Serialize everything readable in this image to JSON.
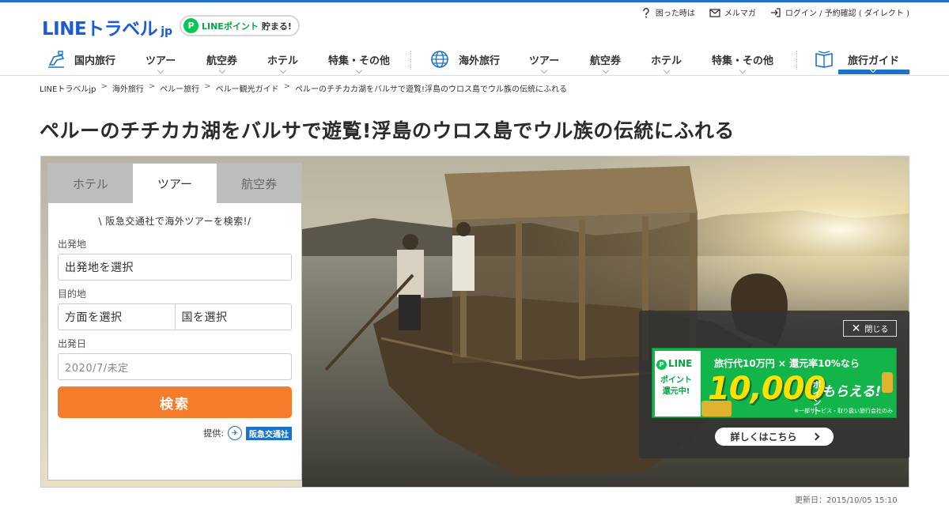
{
  "header": {
    "logo_main": "LINEトラベル",
    "logo_suffix": "jp",
    "point_badge": {
      "icon": "P",
      "line_text": "LINEポイント",
      "rest_text": "貯まる!"
    },
    "util_links": [
      {
        "label": "困った時は",
        "icon": "help-icon"
      },
      {
        "label": "メルマガ",
        "icon": "mail-icon"
      },
      {
        "label": "ログイン / 予約確認 ( ダイレクト )",
        "icon": "login-icon"
      }
    ]
  },
  "nav": {
    "domestic": {
      "label": "国内旅行",
      "items": [
        "ツアー",
        "航空券",
        "ホテル",
        "特集・その他"
      ]
    },
    "overseas": {
      "label": "海外旅行",
      "items": [
        "ツアー",
        "航空券",
        "ホテル",
        "特集・その他"
      ]
    },
    "guide": {
      "label": "旅行ガイド"
    }
  },
  "breadcrumb": [
    "LINEトラベルjp",
    "海外旅行",
    "ペルー旅行",
    "ペルー観光ガイド",
    "ペルーのチチカカ湖をバルサで遊覧!浮島のウロス島でウル族の伝統にふれる"
  ],
  "breadcrumb_sep": ">",
  "page_title": "ペルーのチチカカ湖をバルサで遊覧!浮島のウロス島でウル族の伝統にふれる",
  "search": {
    "tabs": [
      {
        "label": "ホテル",
        "active": false
      },
      {
        "label": "ツアー",
        "active": true
      },
      {
        "label": "航空券",
        "active": false
      }
    ],
    "catch": "\\ 阪急交通社で海外ツアーを検索!/",
    "departure_label": "出発地",
    "departure_value": "出発地を選択",
    "destination_label": "目的地",
    "destination_area": "方面を選択",
    "destination_country": "国を選択",
    "date_label": "出発日",
    "date_placeholder": "2020/7/未定",
    "button_label": "検索",
    "provider_label": "提供:",
    "provider_name": "阪急交通社"
  },
  "promo": {
    "close_label": "閉じる",
    "banner": {
      "line_word": "LINE",
      "left_line1": "ポイント",
      "left_line2": "還元中!",
      "headline": "旅行代10万円 × 還元率10%なら",
      "amount": "10,000",
      "unit": "ポイント",
      "suffix": "もらえる!",
      "note": "※一部サービス・取り扱い旅行会社のみ"
    },
    "detail_button": "詳しくはこちら"
  },
  "updated_text": "更新日：2015/10/05 15:10",
  "colors": {
    "brand_blue": "#1d5bd6",
    "nav_active": "#1a73c8",
    "search_orange": "#f47c2b",
    "line_green": "#06c755"
  }
}
